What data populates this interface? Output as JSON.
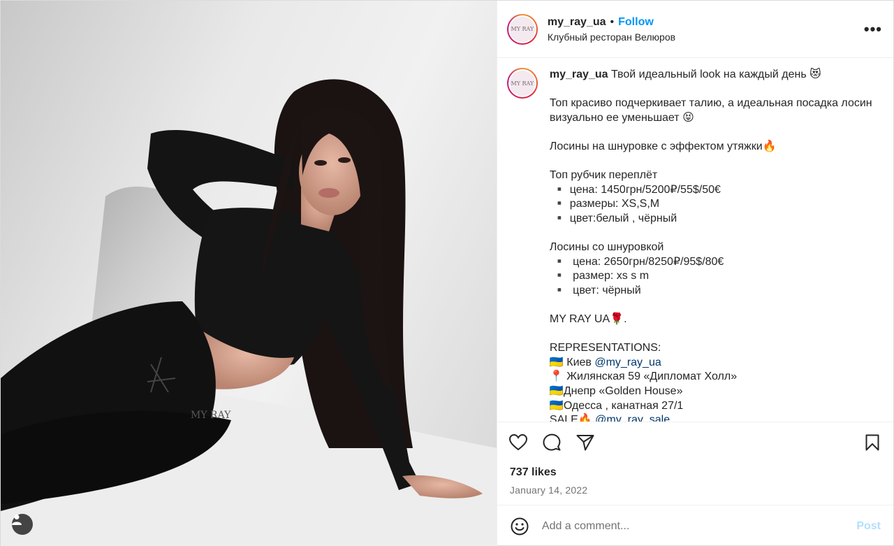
{
  "header": {
    "avatar_text": "MY RAY",
    "username": "my_ray_ua",
    "separator": "•",
    "follow_label": "Follow",
    "location": "Клубный ресторан Велюров",
    "more_label": "•••"
  },
  "caption": {
    "username": "my_ray_ua",
    "lines": [
      "Твой идеальный look на каждый день 😻",
      "",
      "Топ красиво подчеркивает талию, а идеальная посадка лосин",
      "визуально ее уменьшает 😝",
      "",
      "Лосины на шнуровке с эффектом утяжки🔥",
      "",
      "Топ рубчик переплёт",
      " ▪️ цена: 1450грн/5200₽/55$/50€",
      " ▪️ размеры: XS,S,M",
      " ▪️ цвет:белый , чёрный",
      "",
      "Лосины со шнуровкой",
      " ▪️  цена: 2650грн/8250₽/95$/80€",
      " ▪️  размер: xs s m",
      " ▪️  цвет: чёрный",
      "",
      "MY RAY UA🌹.",
      "",
      "REPRESENTATIONS:",
      "🇺🇦 Киев ",
      "📍 Жилянская 59 «Дипломат Холл»",
      "🇺🇦Днепр «Golden House»",
      "🇺🇦Одесса , канатная 27/1",
      "SALE🔥 "
    ],
    "mention_kiev": "@my_ray_ua",
    "mention_sale": "@my_ray_sale"
  },
  "image": {
    "watermark": "MY RAY",
    "tag_icon": "user-icon"
  },
  "actions": {
    "like_icon": "heart-icon",
    "comment_icon": "comment-icon",
    "share_icon": "share-icon",
    "save_icon": "bookmark-icon"
  },
  "likes": "737 likes",
  "date": "January 14, 2022",
  "comment_box": {
    "emoji_icon": "emoji-icon",
    "placeholder": "Add a comment...",
    "post_label": "Post"
  },
  "colors": {
    "accent": "#0095f6",
    "post_disabled": "#b2dffc",
    "secondary_text": "#737373",
    "border": "#efefef"
  }
}
